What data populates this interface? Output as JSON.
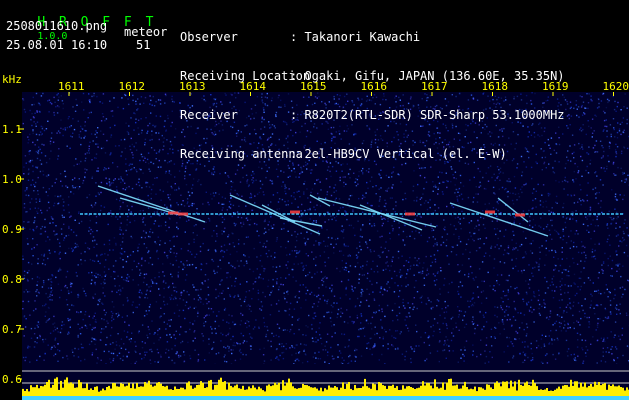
{
  "app": {
    "name": "H R O F F T",
    "version": "1.0.0"
  },
  "file": {
    "name": "2508011610.png",
    "datetime": "25.08.01 16:10"
  },
  "meteor": {
    "label": "meteor",
    "count": "51"
  },
  "info": {
    "labels": [
      "Observer",
      "Receiving Location",
      "Receiver",
      "Receiving antenna"
    ],
    "values": [
      ": Takanori Kawachi",
      ": Ogaki, Gifu, JAPAN (136.60E, 35.35N)",
      ": R820T2(RTL-SDR) SDR-Sharp 53.1000MHz",
      ": 2el-HB9CV Vertical (el. E-W)"
    ]
  },
  "axis": {
    "unit": "kHz",
    "x_ticks": [
      "1611",
      "1612",
      "1613",
      "1614",
      "1615",
      "1616",
      "1617",
      "1618",
      "1619",
      "1620"
    ],
    "y_ticks": [
      "1.1",
      "1.0",
      "0.9",
      "0.8",
      "0.7",
      "0.6"
    ],
    "y_values": [
      1.1,
      1.0,
      0.9,
      0.8,
      0.7,
      0.6
    ]
  },
  "colors": {
    "app_title": "#00ff00",
    "info_text": "#ffffff",
    "ticks": "#ffff00",
    "background": "#00002a",
    "meteor_trail": "#ff4040",
    "carrier_line": "#3fc8ff"
  }
}
